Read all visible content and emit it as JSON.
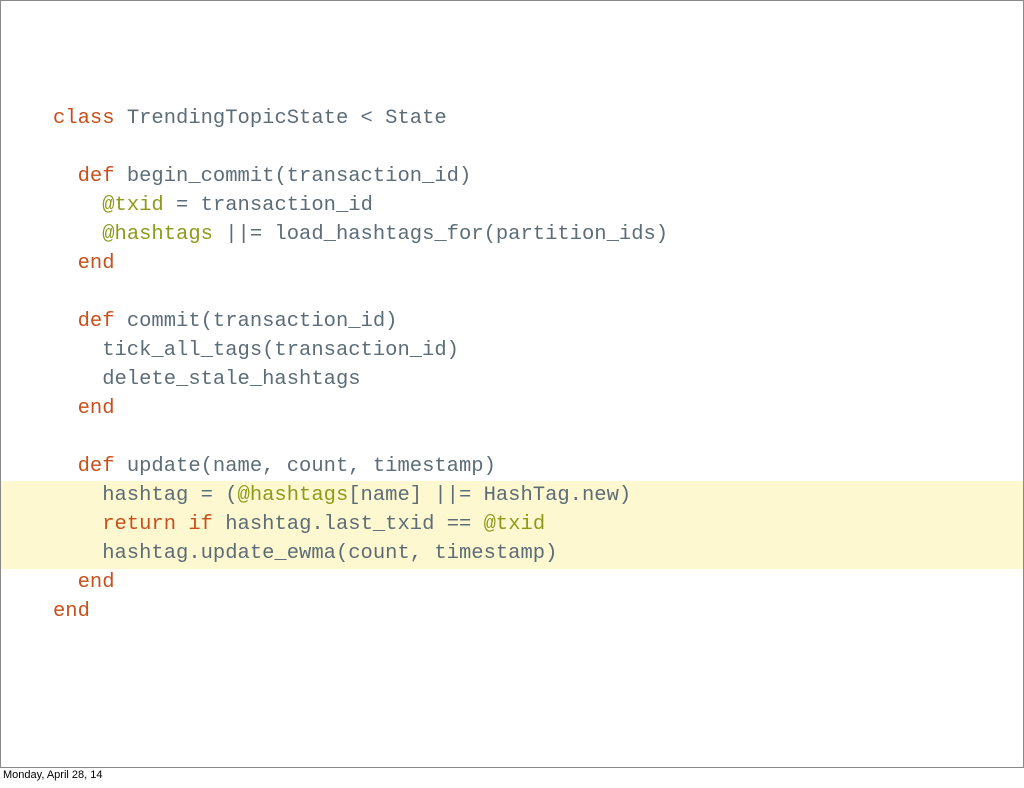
{
  "slide": {
    "code_lines": [
      [
        {
          "t": "class",
          "k": "kw"
        },
        {
          "t": " TrendingTopicState < State",
          "k": "plain"
        }
      ],
      [],
      [
        {
          "t": "  ",
          "k": "plain"
        },
        {
          "t": "def",
          "k": "kw"
        },
        {
          "t": " begin_commit(transaction_id)",
          "k": "plain"
        }
      ],
      [
        {
          "t": "    ",
          "k": "plain"
        },
        {
          "t": "@txid",
          "k": "ivar"
        },
        {
          "t": " = transaction_id",
          "k": "plain"
        }
      ],
      [
        {
          "t": "    ",
          "k": "plain"
        },
        {
          "t": "@hashtags",
          "k": "ivar"
        },
        {
          "t": " ||= load_hashtags_for(partition_ids)",
          "k": "plain"
        }
      ],
      [
        {
          "t": "  ",
          "k": "plain"
        },
        {
          "t": "end",
          "k": "kw"
        }
      ],
      [],
      [
        {
          "t": "  ",
          "k": "plain"
        },
        {
          "t": "def",
          "k": "kw"
        },
        {
          "t": " commit(transaction_id)",
          "k": "plain"
        }
      ],
      [
        {
          "t": "    tick_all_tags(transaction_id)",
          "k": "plain"
        }
      ],
      [
        {
          "t": "    delete_stale_hashtags",
          "k": "plain"
        }
      ],
      [
        {
          "t": "  ",
          "k": "plain"
        },
        {
          "t": "end",
          "k": "kw"
        }
      ],
      [],
      [
        {
          "t": "  ",
          "k": "plain"
        },
        {
          "t": "def",
          "k": "kw"
        },
        {
          "t": " update(name, count, timestamp)",
          "k": "plain"
        }
      ],
      [
        {
          "t": "    hashtag = (",
          "k": "plain"
        },
        {
          "t": "@hashtags",
          "k": "ivar"
        },
        {
          "t": "[name] ||= HashTag.new)",
          "k": "plain"
        }
      ],
      [
        {
          "t": "    ",
          "k": "plain"
        },
        {
          "t": "return",
          "k": "kw"
        },
        {
          "t": " ",
          "k": "plain"
        },
        {
          "t": "if",
          "k": "kw"
        },
        {
          "t": " hashtag.last_txid == ",
          "k": "plain"
        },
        {
          "t": "@txid",
          "k": "ivar"
        }
      ],
      [
        {
          "t": "    hashtag.update_ewma(count, timestamp)",
          "k": "plain"
        }
      ],
      [
        {
          "t": "  ",
          "k": "plain"
        },
        {
          "t": "end",
          "k": "kw"
        }
      ],
      [
        {
          "t": "end",
          "k": "kw"
        }
      ]
    ]
  },
  "footer": {
    "date": "Monday, April 28, 14"
  },
  "colors": {
    "keyword": "#c8501c",
    "instance_variable": "#8e9a1c",
    "plain_text": "#5c6d78",
    "highlight_background": "#fdf8d0"
  }
}
